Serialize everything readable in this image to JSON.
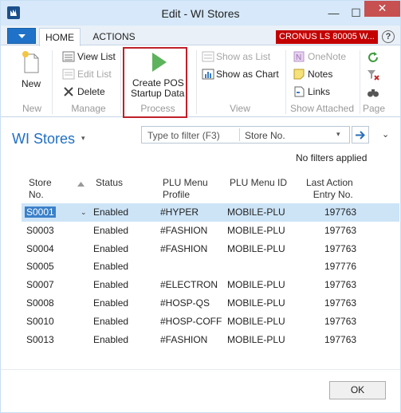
{
  "window": {
    "title": "Edit - WI Stores",
    "minimize_glyph": "—",
    "maximize_glyph": "☐",
    "close_glyph": "✕"
  },
  "ribbon": {
    "tabs": [
      {
        "label": "HOME",
        "active": true
      },
      {
        "label": "ACTIONS",
        "active": false
      }
    ],
    "company": "CRONUS LS 80005 W...",
    "help_glyph": "?",
    "groups": {
      "new": {
        "label": "New",
        "buttons": {
          "new": "New"
        }
      },
      "manage": {
        "label": "Manage",
        "buttons": {
          "view_list": "View List",
          "edit_list": "Edit List",
          "delete": "Delete"
        }
      },
      "process": {
        "label": "Process",
        "buttons": {
          "create_pos_line1": "Create POS",
          "create_pos_line2": "Startup Data"
        }
      },
      "view": {
        "label": "View",
        "buttons": {
          "show_as_list": "Show as List",
          "show_as_chart": "Show as Chart"
        }
      },
      "show_attached": {
        "label": "Show Attached",
        "buttons": {
          "onenote": "OneNote",
          "notes": "Notes",
          "links": "Links"
        }
      },
      "page": {
        "label": "Page"
      }
    },
    "accent_highlight": "#c0202a"
  },
  "page": {
    "title": "WI Stores",
    "title_caret": "▾",
    "filter": {
      "placeholder": "Type to filter (F3)",
      "field": "Store No.",
      "dropdown_glyph": "▾"
    },
    "collapse_glyph": "⌄",
    "no_filters": "No filters applied"
  },
  "table": {
    "headers": {
      "store_no": [
        "Store",
        "No."
      ],
      "status": [
        "Status"
      ],
      "plu_profile": [
        "PLU Menu",
        "Profile"
      ],
      "plu_id": [
        "PLU Menu ID"
      ],
      "last_action": [
        "Last Action",
        "Entry No."
      ]
    },
    "rows": [
      {
        "store_no": "S0001",
        "status": "Enabled",
        "plu_profile": "#HYPER",
        "plu_id": "MOBILE-PLU",
        "last_action": "197763",
        "selected": true
      },
      {
        "store_no": "S0003",
        "status": "Enabled",
        "plu_profile": "#FASHION",
        "plu_id": "MOBILE-PLU",
        "last_action": "197763",
        "selected": false
      },
      {
        "store_no": "S0004",
        "status": "Enabled",
        "plu_profile": "#FASHION",
        "plu_id": "MOBILE-PLU",
        "last_action": "197763",
        "selected": false
      },
      {
        "store_no": "S0005",
        "status": "Enabled",
        "plu_profile": "",
        "plu_id": "",
        "last_action": "197776",
        "selected": false
      },
      {
        "store_no": "S0007",
        "status": "Enabled",
        "plu_profile": "#ELECTRON",
        "plu_id": "MOBILE-PLU",
        "last_action": "197763",
        "selected": false
      },
      {
        "store_no": "S0008",
        "status": "Enabled",
        "plu_profile": "#HOSP-QS",
        "plu_id": "MOBILE-PLU",
        "last_action": "197763",
        "selected": false
      },
      {
        "store_no": "S0010",
        "status": "Enabled",
        "plu_profile": "#HOSP-COFF",
        "plu_id": "MOBILE-PLU",
        "last_action": "197763",
        "selected": false
      },
      {
        "store_no": "S0013",
        "status": "Enabled",
        "plu_profile": "#FASHION",
        "plu_id": "MOBILE-PLU",
        "last_action": "197763",
        "selected": false
      }
    ],
    "row_dropdown_glyph": "⌄"
  },
  "footer": {
    "ok_label": "OK"
  }
}
